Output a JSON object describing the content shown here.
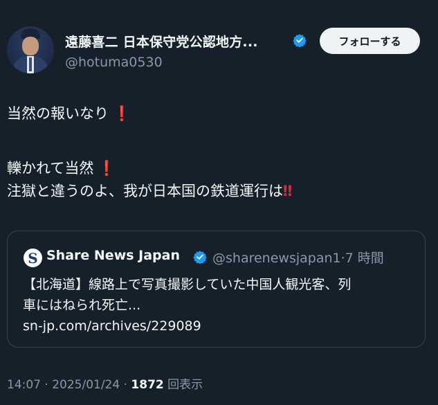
{
  "author": {
    "display_name": "遠藤喜二 日本保守党公認地方...",
    "handle": "@hotuma0530",
    "follow_label": "フォローする"
  },
  "post": {
    "line1": "当然の報いなり",
    "line1_emoji": "❗",
    "line2": "轢かれて当然",
    "line2_emoji": "❗",
    "line3": "注獄と違うのよ、我が日本国の鉄道運行は",
    "line3_emoji": "‼"
  },
  "quote": {
    "avatar_letter": "S",
    "name": "Share News Japan",
    "meta": "@sharenewsjapan1·7 時間",
    "text_line1": "【北海道】線路上で写真撮影していた中国人観光客、列",
    "text_line2": "車にはねられ死亡...",
    "link": "sn-jp.com/archives/229089"
  },
  "footer": {
    "time_date": "14:07 · 2025/01/24 · ",
    "views_count": "1872",
    "views_label": " 回表示"
  },
  "colors": {
    "background": "#15202b",
    "verified_blue": "#1d9bf0",
    "emoji_red": "#e0283d"
  }
}
